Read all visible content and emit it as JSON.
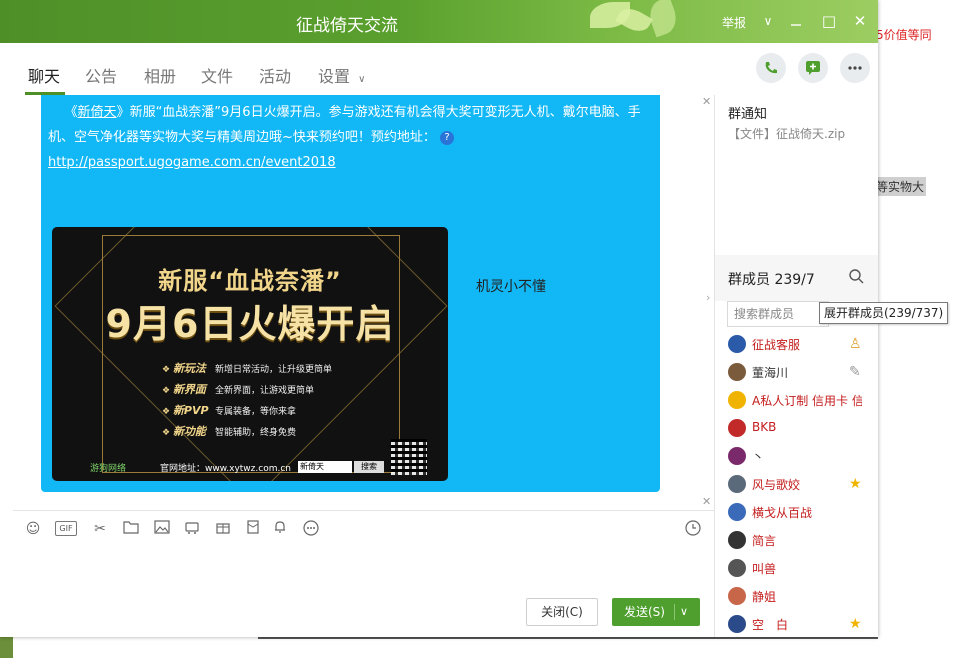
{
  "window": {
    "title": "征战倚天交流",
    "report_label": "举报",
    "minimize_glyph": "□",
    "close_glyph": "✕",
    "menu_glyph": "∨"
  },
  "background": {
    "right_red_text": "5价值等同",
    "right_gray_text": "等实物大"
  },
  "tabs": [
    {
      "label": "聊天",
      "active": true
    },
    {
      "label": "公告"
    },
    {
      "label": "相册"
    },
    {
      "label": "文件"
    },
    {
      "label": "活动"
    },
    {
      "label": "设置"
    }
  ],
  "chat": {
    "message_prefix": "《",
    "message_game": "新倚天",
    "message_text": "》新服“血战奈潘”9月6日火爆开启。参与游戏还有机会得大奖可变形无人机、戴尔电脑、手机、空气净化器等实物大奖与精美周边哦~快来预约吧！预约地址：",
    "help_glyph": "?",
    "link": "http://passport.ugogame.com.cn/event2018",
    "poster": {
      "subtitle": "新服“血战奈潘”",
      "headline": "9月6日火爆开启",
      "features": [
        {
          "key": "新玩法",
          "desc": "新增日常活动，让升级更简单"
        },
        {
          "key": "新界面",
          "desc": "全新界面，让游戏更简单"
        },
        {
          "key": "新PVP",
          "desc": "专属装备，等你来拿"
        },
        {
          "key": "新功能",
          "desc": "智能辅助，终身免费"
        }
      ],
      "publisher": "游狗网络",
      "site": "官网地址：www.xytwz.com.cn",
      "search_value": "新倚天",
      "search_button": "搜索"
    },
    "sender_label": "机灵小不懂"
  },
  "composer": {
    "gif_label": "GIF",
    "close_button": "关闭(C)",
    "send_button": "发送(S)"
  },
  "right_panel": {
    "notice_title": "群通知",
    "notice_body": "【文件】征战倚天.zip",
    "members_title": "群成员 239/7",
    "search_placeholder": "搜索群成员",
    "tooltip": "展开群成员(239/737)",
    "members": [
      {
        "name": "征战客服",
        "avatar_color": "#2a5aa8",
        "badge": "owner"
      },
      {
        "name": "董海川",
        "avatar_color": "#7a5b3c",
        "badge": "edit"
      },
      {
        "name": "A私人订制 信用卡 信",
        "avatar_color": "#f0b400",
        "badge": ""
      },
      {
        "name": "BKB",
        "avatar_color": "#c22a2a",
        "badge": ""
      },
      {
        "name": "丶",
        "avatar_color": "#7a2a6a",
        "badge": ""
      },
      {
        "name": "风与歌姣",
        "avatar_color": "#5a6a7a",
        "badge": "star"
      },
      {
        "name": "横戈从百战",
        "avatar_color": "#3a6ab8",
        "badge": ""
      },
      {
        "name": "简言",
        "avatar_color": "#333333",
        "badge": ""
      },
      {
        "name": "叫兽",
        "avatar_color": "#555555",
        "badge": ""
      },
      {
        "name": "静姐",
        "avatar_color": "#c8664a",
        "badge": ""
      },
      {
        "name": "空　白",
        "avatar_color": "#2a4a8a",
        "badge": "star"
      }
    ]
  }
}
